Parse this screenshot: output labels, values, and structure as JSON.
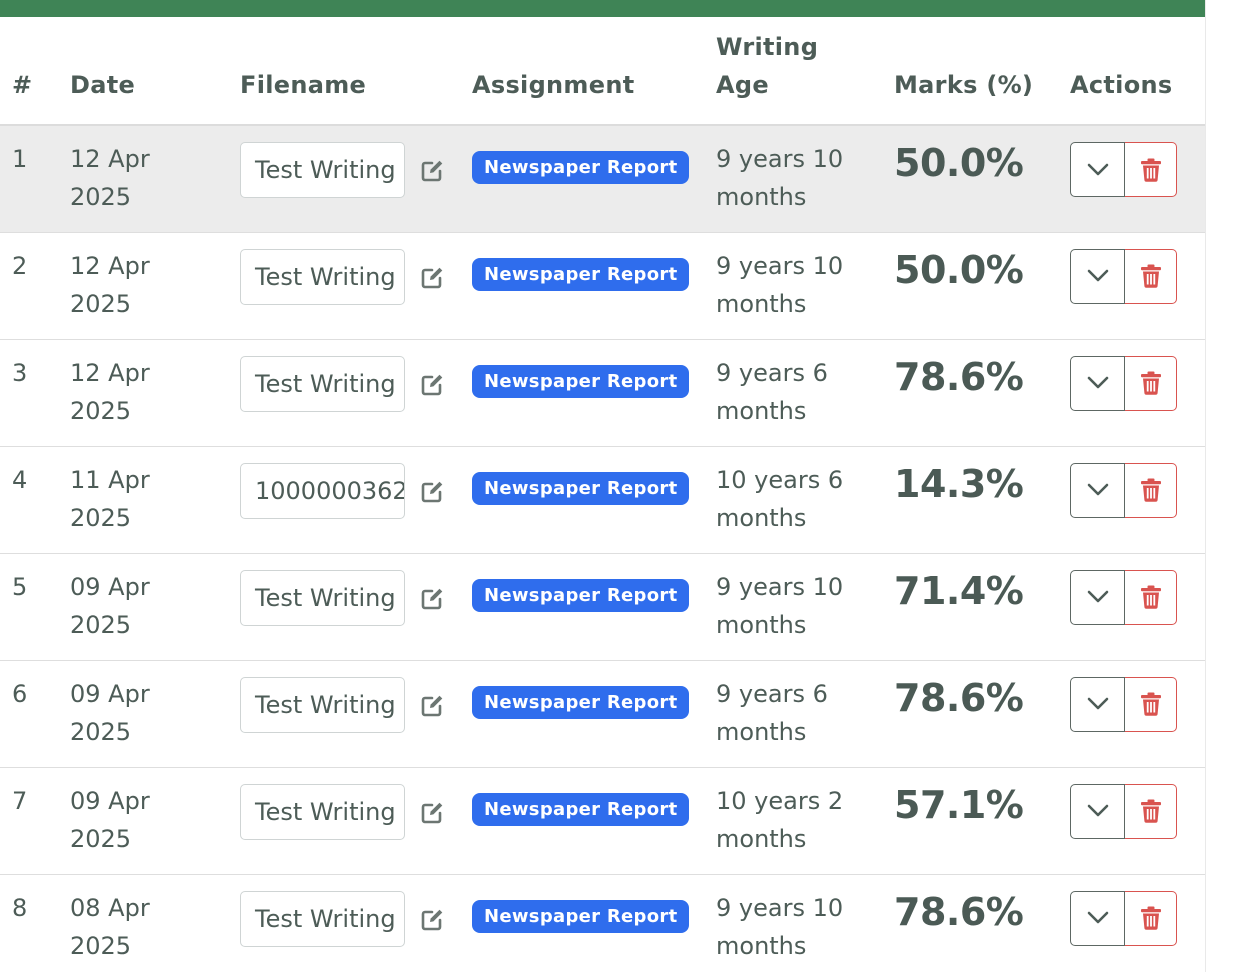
{
  "table": {
    "headers": {
      "num": "#",
      "date": "Date",
      "filename": "Filename",
      "assignment": "Assignment",
      "writing_age_line1": "Writing",
      "writing_age_line2": "Age",
      "marks": "Marks (%)",
      "actions": "Actions"
    },
    "rows": [
      {
        "num": "1",
        "date_line1": "12 Apr",
        "date_line2": "2025",
        "filename": "Test Writing",
        "assignment": "Newspaper Report",
        "age_line1": "9 years 10",
        "age_line2": "months",
        "marks": "50.0%"
      },
      {
        "num": "2",
        "date_line1": "12 Apr",
        "date_line2": "2025",
        "filename": "Test Writing",
        "assignment": "Newspaper Report",
        "age_line1": "9 years 10",
        "age_line2": "months",
        "marks": "50.0%"
      },
      {
        "num": "3",
        "date_line1": "12 Apr",
        "date_line2": "2025",
        "filename": "Test Writing",
        "assignment": "Newspaper Report",
        "age_line1": "9 years 6",
        "age_line2": "months",
        "marks": "78.6%"
      },
      {
        "num": "4",
        "date_line1": "11 Apr",
        "date_line2": "2025",
        "filename": "1000000362",
        "assignment": "Newspaper Report",
        "age_line1": "10 years 6",
        "age_line2": "months",
        "marks": "14.3%"
      },
      {
        "num": "5",
        "date_line1": "09 Apr",
        "date_line2": "2025",
        "filename": "Test Writing",
        "assignment": "Newspaper Report",
        "age_line1": "9 years 10",
        "age_line2": "months",
        "marks": "71.4%"
      },
      {
        "num": "6",
        "date_line1": "09 Apr",
        "date_line2": "2025",
        "filename": "Test Writing",
        "assignment": "Newspaper Report",
        "age_line1": "9 years 6",
        "age_line2": "months",
        "marks": "78.6%"
      },
      {
        "num": "7",
        "date_line1": "09 Apr",
        "date_line2": "2025",
        "filename": "Test Writing",
        "assignment": "Newspaper Report",
        "age_line1": "10 years 2",
        "age_line2": "months",
        "marks": "57.1%"
      },
      {
        "num": "8",
        "date_line1": "08 Apr",
        "date_line2": "2025",
        "filename": "Test Writing",
        "assignment": "Newspaper Report",
        "age_line1": "9 years 10",
        "age_line2": "months",
        "marks": "78.6%"
      }
    ]
  },
  "colors": {
    "header_bar": "#3f8456",
    "badge": "#2f6ded",
    "delete": "#d9534f",
    "highlight_row": "#ececec"
  },
  "icons": {
    "edit": "edit-icon",
    "expand": "chevron-down-icon",
    "delete": "trash-icon"
  }
}
